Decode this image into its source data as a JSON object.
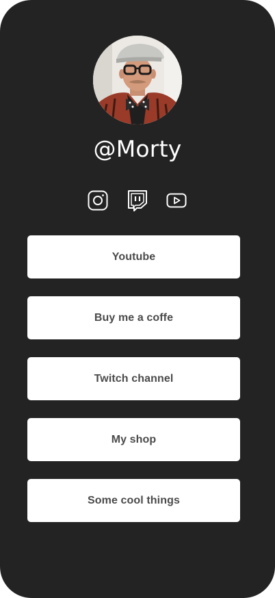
{
  "profile": {
    "handle": "@Morty",
    "avatar_icon": "portrait-photo"
  },
  "socials": [
    {
      "name": "instagram",
      "icon": "instagram-icon"
    },
    {
      "name": "twitch",
      "icon": "twitch-icon"
    },
    {
      "name": "youtube",
      "icon": "youtube-icon"
    }
  ],
  "links": [
    {
      "label": "Youtube"
    },
    {
      "label": "Buy me a coffe"
    },
    {
      "label": "Twitch channel"
    },
    {
      "label": "My shop"
    },
    {
      "label": "Some cool things"
    }
  ],
  "colors": {
    "background": "#232323",
    "button": "#ffffff",
    "button_text": "#4a4a4a",
    "handle_text": "#ffffff"
  }
}
